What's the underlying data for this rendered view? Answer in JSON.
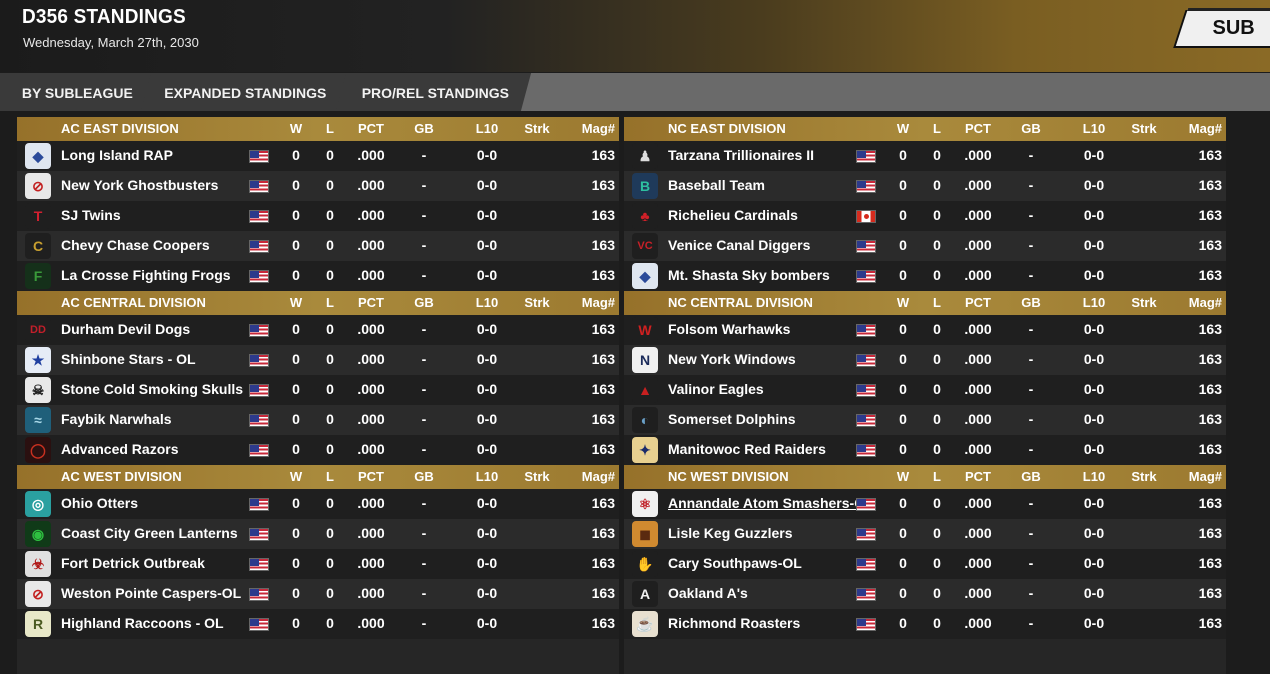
{
  "header": {
    "title": "D356 STANDINGS",
    "date": "Wednesday, March 27th, 2030",
    "sub_button": "SUB"
  },
  "tabs": [
    {
      "label": "BY SUBLEAGUE"
    },
    {
      "label": "EXPANDED STANDINGS"
    },
    {
      "label": "PRO/REL STANDINGS"
    }
  ],
  "columns": {
    "w": "W",
    "l": "L",
    "pct": "PCT",
    "gb": "GB",
    "l10": "L10",
    "strk": "Strk",
    "mag": "Mag#"
  },
  "colors": {
    "division_header": "#a08032",
    "tab_active": "#3a3a3a"
  },
  "panels": [
    {
      "divisions": [
        {
          "name": "AC EAST DIVISION",
          "teams": [
            {
              "name": "Long Island RAP",
              "flag": "us",
              "logo_icon": "diamond-logo-icon",
              "w": "0",
              "l": "0",
              "pct": ".000",
              "gb": "-",
              "l10": "0-0",
              "strk": "",
              "mag": "163"
            },
            {
              "name": "New York Ghostbusters",
              "flag": "us",
              "logo_icon": "ghost-logo-icon",
              "w": "0",
              "l": "0",
              "pct": ".000",
              "gb": "-",
              "l10": "0-0",
              "strk": "",
              "mag": "163"
            },
            {
              "name": "SJ Twins",
              "flag": "us",
              "logo_icon": "t-letter-logo-icon",
              "w": "0",
              "l": "0",
              "pct": ".000",
              "gb": "-",
              "l10": "0-0",
              "strk": "",
              "mag": "163"
            },
            {
              "name": "Chevy Chase Coopers",
              "flag": "us",
              "logo_icon": "c-letter-logo-icon",
              "w": "0",
              "l": "0",
              "pct": ".000",
              "gb": "-",
              "l10": "0-0",
              "strk": "",
              "mag": "163"
            },
            {
              "name": "La Crosse Fighting Frogs",
              "flag": "us",
              "logo_icon": "f-letter-logo-icon",
              "w": "0",
              "l": "0",
              "pct": ".000",
              "gb": "-",
              "l10": "0-0",
              "strk": "",
              "mag": "163"
            }
          ]
        },
        {
          "name": "AC CENTRAL DIVISION",
          "teams": [
            {
              "name": "Durham Devil Dogs",
              "flag": "us",
              "logo_icon": "dd-letters-logo-icon",
              "w": "0",
              "l": "0",
              "pct": ".000",
              "gb": "-",
              "l10": "0-0",
              "strk": "",
              "mag": "163"
            },
            {
              "name": "Shinbone Stars - OL",
              "flag": "us",
              "logo_icon": "stars-logo-icon",
              "w": "0",
              "l": "0",
              "pct": ".000",
              "gb": "-",
              "l10": "0-0",
              "strk": "",
              "mag": "163"
            },
            {
              "name": "Stone Cold Smoking Skulls",
              "flag": "us",
              "logo_icon": "skull-logo-icon",
              "w": "0",
              "l": "0",
              "pct": ".000",
              "gb": "-",
              "l10": "0-0",
              "strk": "",
              "mag": "163"
            },
            {
              "name": "Faybik Narwhals",
              "flag": "us",
              "logo_icon": "narwhal-logo-icon",
              "w": "0",
              "l": "0",
              "pct": ".000",
              "gb": "-",
              "l10": "0-0",
              "strk": "",
              "mag": "163"
            },
            {
              "name": "Advanced Razors",
              "flag": "us",
              "logo_icon": "ring-logo-icon",
              "w": "0",
              "l": "0",
              "pct": ".000",
              "gb": "-",
              "l10": "0-0",
              "strk": "",
              "mag": "163"
            }
          ]
        },
        {
          "name": "AC WEST DIVISION",
          "teams": [
            {
              "name": "Ohio Otters",
              "flag": "us",
              "logo_icon": "otter-logo-icon",
              "w": "0",
              "l": "0",
              "pct": ".000",
              "gb": "-",
              "l10": "0-0",
              "strk": "",
              "mag": "163"
            },
            {
              "name": "Coast City Green Lanterns",
              "flag": "us",
              "logo_icon": "lantern-logo-icon",
              "w": "0",
              "l": "0",
              "pct": ".000",
              "gb": "-",
              "l10": "0-0",
              "strk": "",
              "mag": "163"
            },
            {
              "name": "Fort Detrick Outbreak",
              "flag": "us",
              "logo_icon": "biohazard-logo-icon",
              "w": "0",
              "l": "0",
              "pct": ".000",
              "gb": "-",
              "l10": "0-0",
              "strk": "",
              "mag": "163"
            },
            {
              "name": "Weston Pointe Caspers-OL",
              "flag": "us",
              "logo_icon": "ghost-logo-icon",
              "w": "0",
              "l": "0",
              "pct": ".000",
              "gb": "-",
              "l10": "0-0",
              "strk": "",
              "mag": "163"
            },
            {
              "name": "Highland Raccoons - OL",
              "flag": "us",
              "logo_icon": "raccoon-logo-icon",
              "w": "0",
              "l": "0",
              "pct": ".000",
              "gb": "-",
              "l10": "0-0",
              "strk": "",
              "mag": "163"
            }
          ]
        }
      ]
    },
    {
      "divisions": [
        {
          "name": "NC EAST DIVISION",
          "teams": [
            {
              "name": "Tarzana Trillionaires II",
              "flag": "us",
              "logo_icon": "mascot-logo-icon",
              "w": "0",
              "l": "0",
              "pct": ".000",
              "gb": "-",
              "l10": "0-0",
              "strk": "",
              "mag": "163"
            },
            {
              "name": "Baseball Team",
              "flag": "us",
              "logo_icon": "b-letter-logo-icon",
              "w": "0",
              "l": "0",
              "pct": ".000",
              "gb": "-",
              "l10": "0-0",
              "strk": "",
              "mag": "163"
            },
            {
              "name": "Richelieu Cardinals",
              "flag": "ca",
              "logo_icon": "cardinal-logo-icon",
              "w": "0",
              "l": "0",
              "pct": ".000",
              "gb": "-",
              "l10": "0-0",
              "strk": "",
              "mag": "163"
            },
            {
              "name": "Venice Canal Diggers",
              "flag": "us",
              "logo_icon": "vc-letters-logo-icon",
              "w": "0",
              "l": "0",
              "pct": ".000",
              "gb": "-",
              "l10": "0-0",
              "strk": "",
              "mag": "163"
            },
            {
              "name": "Mt. Shasta Sky bombers",
              "flag": "us",
              "logo_icon": "diamond-logo-icon",
              "w": "0",
              "l": "0",
              "pct": ".000",
              "gb": "-",
              "l10": "0-0",
              "strk": "",
              "mag": "163"
            }
          ]
        },
        {
          "name": "NC CENTRAL DIVISION",
          "teams": [
            {
              "name": "Folsom Warhawks",
              "flag": "us",
              "logo_icon": "w-letter-logo-icon",
              "w": "0",
              "l": "0",
              "pct": ".000",
              "gb": "-",
              "l10": "0-0",
              "strk": "",
              "mag": "163"
            },
            {
              "name": "New York Windows",
              "flag": "us",
              "logo_icon": "n-letter-logo-icon",
              "w": "0",
              "l": "0",
              "pct": ".000",
              "gb": "-",
              "l10": "0-0",
              "strk": "",
              "mag": "163"
            },
            {
              "name": "Valinor Eagles",
              "flag": "us",
              "logo_icon": "eagle-logo-icon",
              "w": "0",
              "l": "0",
              "pct": ".000",
              "gb": "-",
              "l10": "0-0",
              "strk": "",
              "mag": "163"
            },
            {
              "name": "Somerset Dolphins",
              "flag": "us",
              "logo_icon": "dolphin-logo-icon",
              "w": "0",
              "l": "0",
              "pct": ".000",
              "gb": "-",
              "l10": "0-0",
              "strk": "",
              "mag": "163"
            },
            {
              "name": "Manitowoc Red Raiders",
              "flag": "us",
              "logo_icon": "glove-logo-icon",
              "w": "0",
              "l": "0",
              "pct": ".000",
              "gb": "-",
              "l10": "0-0",
              "strk": "",
              "mag": "163"
            }
          ]
        },
        {
          "name": "NC WEST DIVISION",
          "teams": [
            {
              "name": "Annandale Atom Smashers-OL",
              "flag": "us",
              "logo_icon": "atom-logo-icon",
              "w": "0",
              "l": "0",
              "pct": ".000",
              "gb": "-",
              "l10": "0-0",
              "strk": "",
              "mag": "163",
              "underlined": true
            },
            {
              "name": "Lisle Keg Guzzlers",
              "flag": "us",
              "logo_icon": "keg-logo-icon",
              "w": "0",
              "l": "0",
              "pct": ".000",
              "gb": "-",
              "l10": "0-0",
              "strk": "",
              "mag": "163"
            },
            {
              "name": "Cary Southpaws-OL",
              "flag": "us",
              "logo_icon": "paw-logo-icon",
              "w": "0",
              "l": "0",
              "pct": ".000",
              "gb": "-",
              "l10": "0-0",
              "strk": "",
              "mag": "163"
            },
            {
              "name": "Oakland A's",
              "flag": "us",
              "logo_icon": "a-letter-logo-icon",
              "w": "0",
              "l": "0",
              "pct": ".000",
              "gb": "-",
              "l10": "0-0",
              "strk": "",
              "mag": "163"
            },
            {
              "name": "Richmond Roasters",
              "flag": "us",
              "logo_icon": "coffee-logo-icon",
              "w": "0",
              "l": "0",
              "pct": ".000",
              "gb": "-",
              "l10": "0-0",
              "strk": "",
              "mag": "163"
            }
          ]
        }
      ]
    }
  ]
}
